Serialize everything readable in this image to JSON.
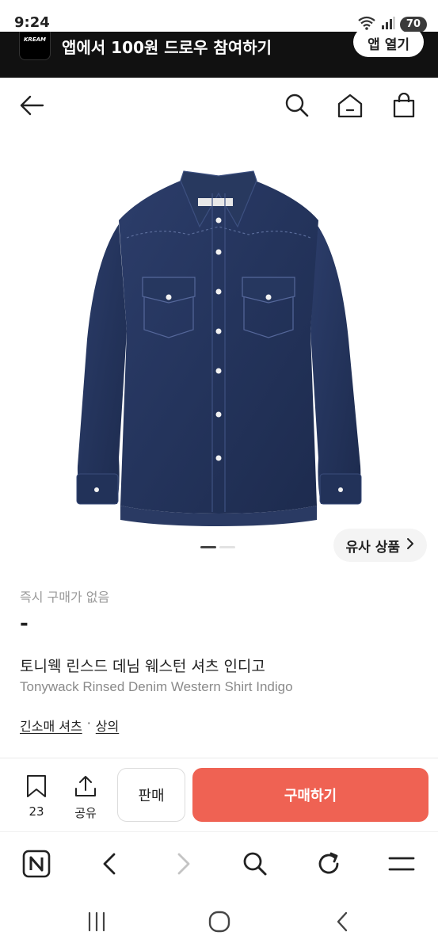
{
  "status_bar": {
    "time": "9:24",
    "battery": "70",
    "icons": [
      "wifi-icon",
      "signal-icon",
      "battery-icon"
    ]
  },
  "app_banner": {
    "logo_text": "KREAM",
    "text": "앱에서 100원 드로우 참여하기",
    "button_label": "앱 열기"
  },
  "header": {
    "icons": [
      "back-arrow-icon",
      "search-icon",
      "home-icon",
      "shopping-bag-icon"
    ]
  },
  "product": {
    "image_alt_icon": "denim-shirt-image",
    "carousel": {
      "count": 2,
      "active": 0
    },
    "similar_label": "유사 상품",
    "instant_buy_label": "즉시 구매가 없음",
    "price": "-",
    "title_ko": "토니웩 린스드 데님 웨스턴 셔츠 인디고",
    "title_en": "Tonywack Rinsed Denim Western Shirt Indigo",
    "categories": [
      "긴소매 셔츠",
      "상의"
    ],
    "category_separator": "·"
  },
  "action_bar": {
    "wishlist_count": "23",
    "share_label": "공유",
    "sell_label": "판매",
    "buy_label": "구매하기",
    "buy_color": "#ef6253"
  },
  "browser_bar": {
    "icons": [
      "naver-n-icon",
      "back-icon",
      "forward-icon",
      "search-icon",
      "refresh-icon",
      "menu-icon"
    ]
  },
  "system_nav": {
    "icons": [
      "recents-icon",
      "home-circle-icon",
      "back-chevron-icon"
    ]
  }
}
